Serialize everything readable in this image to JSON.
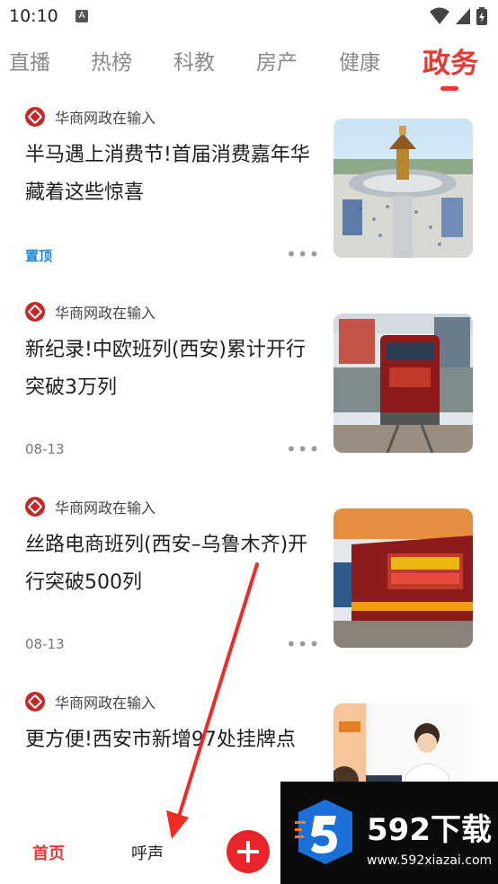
{
  "status_bar": {
    "time": "10:10",
    "notification_badge": "A"
  },
  "tabs": [
    {
      "label": "直播",
      "active": false
    },
    {
      "label": "热榜",
      "active": false
    },
    {
      "label": "科教",
      "active": false
    },
    {
      "label": "房产",
      "active": false
    },
    {
      "label": "健康",
      "active": false
    },
    {
      "label": "政务",
      "active": true
    }
  ],
  "feed": [
    {
      "source": "华商网政在输入",
      "title": "半马遇上消费节!首届消费嘉年华藏着这些惊喜",
      "meta": "置顶",
      "thumb": "plaza-photo"
    },
    {
      "source": "华商网政在输入",
      "title": "新纪录!中欧班列(西安)累计开行突破3万列",
      "meta": "08-13",
      "thumb": "train-photo"
    },
    {
      "source": "华商网政在输入",
      "title": "丝路电商班列(西安–乌鲁木齐)开行突破500列",
      "meta": "08-13",
      "thumb": "train-photo-2"
    },
    {
      "source": "华商网政在输入",
      "title": "更方便!西安市新增97处挂牌点",
      "meta": "",
      "thumb": "office-photo"
    }
  ],
  "bottom_nav": {
    "home": "首页",
    "voice": "呼声"
  },
  "watermark": {
    "brand": "592下载",
    "url": "www.592xiazai.com"
  },
  "colors": {
    "accent": "#e53935",
    "pinned": "#1a88d6"
  }
}
